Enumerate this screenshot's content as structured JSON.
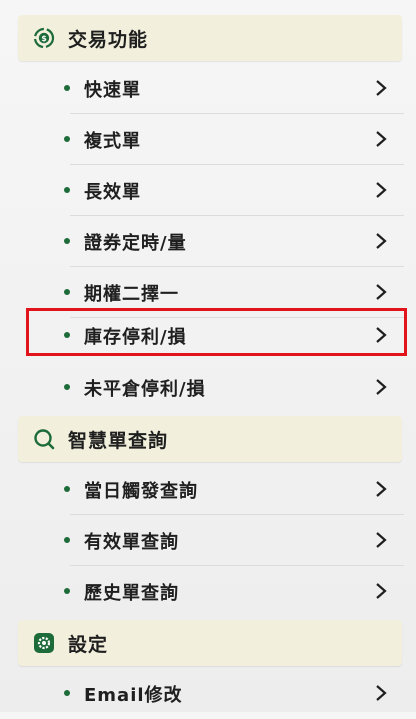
{
  "colors": {
    "accent": "#1d6b38",
    "section_bg": "#f2f0dc",
    "highlight": "#e0141a"
  },
  "sections": [
    {
      "title": "交易功能",
      "icon": "exchange-icon",
      "items": [
        {
          "label": "快速單"
        },
        {
          "label": "複式單"
        },
        {
          "label": "長效單"
        },
        {
          "label": "證券定時/量"
        },
        {
          "label": "期權二擇一"
        },
        {
          "label": "庫存停利/損",
          "highlighted": true
        },
        {
          "label": "未平倉停利/損"
        }
      ]
    },
    {
      "title": "智慧單查詢",
      "icon": "search-icon",
      "items": [
        {
          "label": "當日觸發查詢"
        },
        {
          "label": "有效單查詢"
        },
        {
          "label": "歷史單查詢"
        }
      ]
    },
    {
      "title": "設定",
      "icon": "gear-icon",
      "items": [
        {
          "label": "Email修改"
        }
      ]
    }
  ]
}
